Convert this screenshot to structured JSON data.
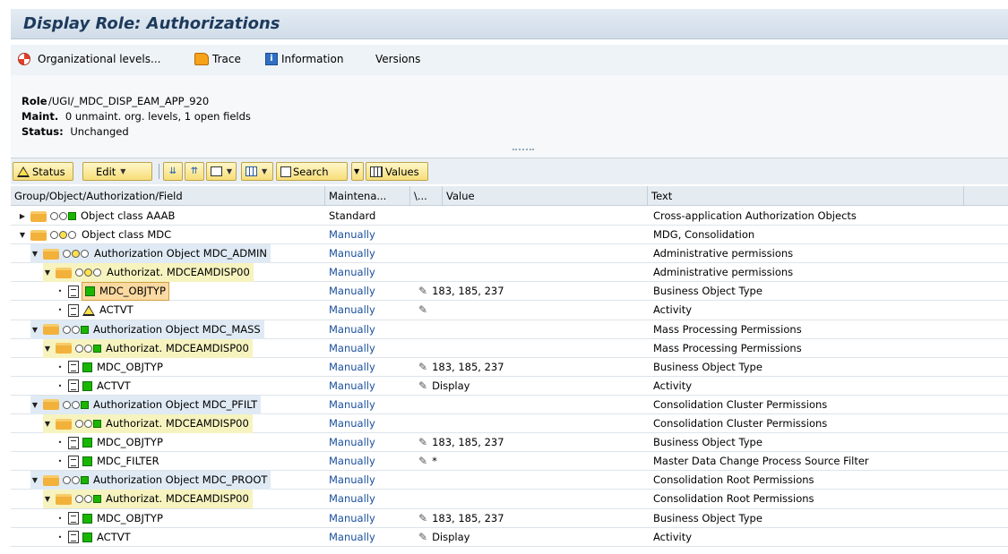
{
  "title": "Display Role: Authorizations",
  "toolbar": {
    "org_levels": "Organizational levels...",
    "trace": "Trace",
    "information": "Information",
    "versions": "Versions"
  },
  "header": {
    "role_label": "Role",
    "role_value": "/UGI/_MDC_DISP_EAM_APP_920",
    "maint_label": "Maint.",
    "maint_value": "0 unmaint. org. levels, 1 open fields",
    "status_label": "Status:",
    "status_value": "Unchanged"
  },
  "alv_toolbar": {
    "status": "Status",
    "edit": "Edit",
    "search": "Search",
    "values": "Values"
  },
  "columns": {
    "name": "Group/Object/Authorization/Field",
    "maint": "Maintena...",
    "flag": "\\...",
    "value": "Value",
    "text": "Text"
  },
  "rows": [
    {
      "name": "Object class AAAB",
      "maint": "Standard",
      "value": "",
      "text": "Cross-application Authorization Objects"
    },
    {
      "name": "Object class MDC",
      "maint": "Manually",
      "value": "",
      "text": "MDG, Consolidation"
    },
    {
      "name": "Authorization Object MDC_ADMIN",
      "maint": "Manually",
      "value": "",
      "text": "Administrative permissions"
    },
    {
      "name": "Authorizat. MDCEAMDISP00",
      "maint": "Manually",
      "value": "",
      "text": "Administrative permissions"
    },
    {
      "name": "MDC_OBJTYP",
      "maint": "Manually",
      "value": "183, 185, 237",
      "text": "Business Object Type"
    },
    {
      "name": "ACTVT",
      "maint": "Manually",
      "value": "",
      "text": "Activity"
    },
    {
      "name": "Authorization Object MDC_MASS",
      "maint": "Manually",
      "value": "",
      "text": "Mass Processing Permissions"
    },
    {
      "name": "Authorizat. MDCEAMDISP00",
      "maint": "Manually",
      "value": "",
      "text": "Mass Processing Permissions"
    },
    {
      "name": "MDC_OBJTYP",
      "maint": "Manually",
      "value": "183, 185, 237",
      "text": "Business Object Type"
    },
    {
      "name": "ACTVT",
      "maint": "Manually",
      "value": "Display",
      "text": "Activity"
    },
    {
      "name": "Authorization Object MDC_PFILT",
      "maint": "Manually",
      "value": "",
      "text": "Consolidation Cluster Permissions"
    },
    {
      "name": "Authorizat. MDCEAMDISP00",
      "maint": "Manually",
      "value": "",
      "text": "Consolidation Cluster Permissions"
    },
    {
      "name": "MDC_OBJTYP",
      "maint": "Manually",
      "value": "183, 185, 237",
      "text": "Business Object Type"
    },
    {
      "name": "MDC_FILTER",
      "maint": "Manually",
      "value": "*",
      "text": "Master Data Change Process Source Filter"
    },
    {
      "name": "Authorization Object MDC_PROOT",
      "maint": "Manually",
      "value": "",
      "text": "Consolidation Root Permissions"
    },
    {
      "name": "Authorizat. MDCEAMDISP00",
      "maint": "Manually",
      "value": "",
      "text": "Consolidation Root Permissions"
    },
    {
      "name": "MDC_OBJTYP",
      "maint": "Manually",
      "value": "183, 185, 237",
      "text": "Business Object Type"
    },
    {
      "name": "ACTVT",
      "maint": "Manually",
      "value": "Display",
      "text": "Activity"
    }
  ]
}
